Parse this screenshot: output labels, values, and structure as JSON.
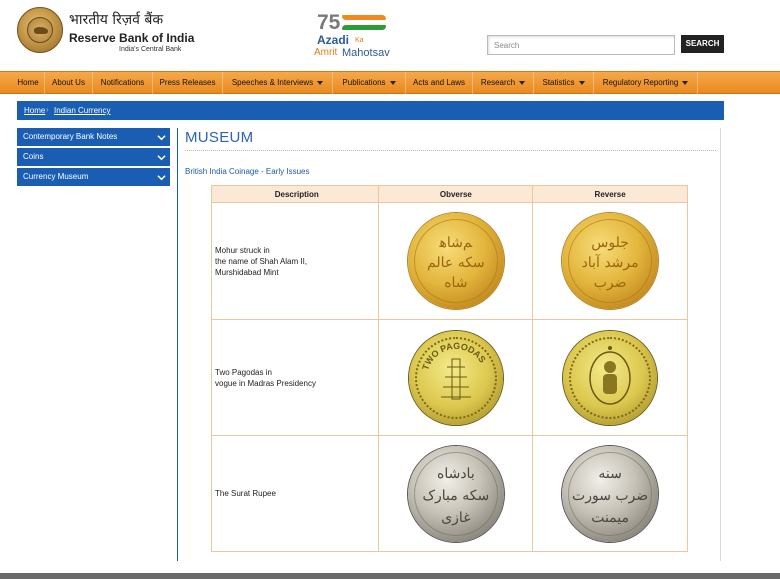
{
  "header": {
    "hindi_title": "भारतीय रिज़र्व बैंक",
    "english_title": "Reserve Bank of India",
    "subtitle": "India's Central Bank",
    "logo_icon": "rbi-seal-icon",
    "campaign": {
      "number": "75",
      "line1": "Azadi",
      "ka": "Ka",
      "line2a": "Amrit",
      "line2b": "Mahotsav"
    },
    "search": {
      "placeholder": "Search",
      "button_label": "SEARCH"
    }
  },
  "nav": {
    "items": [
      {
        "label": "Home",
        "dropdown": false
      },
      {
        "label": "About Us",
        "dropdown": false
      },
      {
        "label": "Notifications",
        "dropdown": false
      },
      {
        "label": "Press Releases",
        "dropdown": false
      },
      {
        "label": "Speeches & Interviews",
        "dropdown": true
      },
      {
        "label": "Publications",
        "dropdown": true
      },
      {
        "label": "Acts and Laws",
        "dropdown": false
      },
      {
        "label": "Research",
        "dropdown": true
      },
      {
        "label": "Statistics",
        "dropdown": true
      },
      {
        "label": "Regulatory Reporting",
        "dropdown": true
      }
    ]
  },
  "breadcrumb": {
    "items": [
      "Home",
      "Indian Currency"
    ]
  },
  "sidebar": {
    "items": [
      {
        "label": "Contemporary Bank Notes"
      },
      {
        "label": "Coins"
      },
      {
        "label": "Currency Museum"
      }
    ]
  },
  "main": {
    "title": "MUSEUM",
    "section_title": "British India Coinage - Early Issues",
    "table": {
      "headers": [
        "Description",
        "Obverse",
        "Reverse"
      ],
      "rows": [
        {
          "description_lines": [
            "Mohur struck in",
            "the name of Shah Alam II,",
            "Murshidabad Mint"
          ],
          "obverse_icon": "gold-mohur-obverse-coin",
          "reverse_icon": "gold-mohur-reverse-coin"
        },
        {
          "description_lines": [
            "Two Pagodas in",
            "vogue in Madras Presidency"
          ],
          "obverse_icon": "two-pagodas-obverse-coin",
          "reverse_icon": "two-pagodas-reverse-coin",
          "obverse_text": "TWO PAGODAS"
        },
        {
          "description_lines": [
            "The Surat Rupee"
          ],
          "obverse_icon": "surat-rupee-obverse-coin",
          "reverse_icon": "surat-rupee-reverse-coin"
        }
      ]
    }
  },
  "colors": {
    "brand_blue": "#1a5eb4",
    "nav_orange": "#ee9530",
    "table_header": "#fbe9d6"
  }
}
